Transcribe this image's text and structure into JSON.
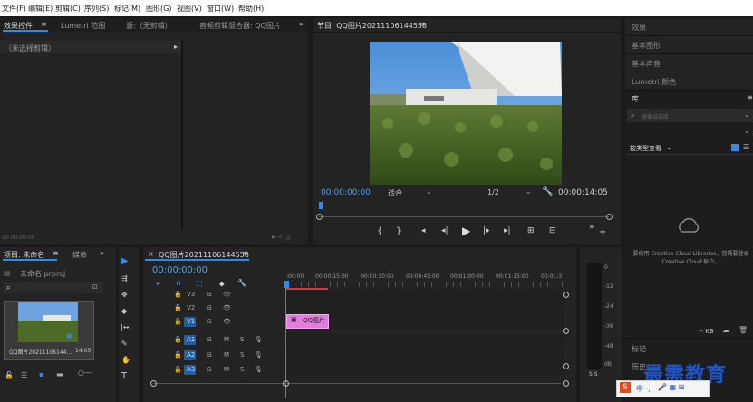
{
  "menu": [
    "文件(F)",
    "编辑(E)",
    "剪辑(C)",
    "序列(S)",
    "标记(M)",
    "图形(G)",
    "视图(V)",
    "窗口(W)",
    "帮助(H)"
  ],
  "source_panel": {
    "tabs": [
      "效果控件",
      "Lumetri 范围",
      "源:（无剪辑）",
      "音频剪辑混合器: QQ图片"
    ],
    "no_clip": "（未选择剪辑）",
    "timecode": "00:00:00:00"
  },
  "program": {
    "title": "节目: QQ图片20211106144558",
    "timecode": "00:00:00:00",
    "fit": "适合",
    "ratio": "1/2",
    "duration": "00:00:14:05"
  },
  "right_panel": {
    "items": [
      "效果",
      "基本图形",
      "基本声音",
      "Lumetri 颜色"
    ],
    "library_title": "库",
    "search_placeholder": "搜索当前库",
    "view_by": "按类型查看",
    "cc_message": "要使用 Creative Cloud Libraries，您需要登录 Creative Cloud 帐户。",
    "kb": "-- KB",
    "markers_title": "标记",
    "history_title": "历史"
  },
  "project": {
    "title": "项目: 未命名",
    "tab2": "媒体",
    "file": "未命名.prproj",
    "clip_name": "QQ图片20211106144...",
    "clip_duration": "14:05"
  },
  "timeline": {
    "title": "QQ图片20211106144558",
    "timecode": "00:00:00:00",
    "ruler": [
      ":00:00",
      "00:00:15:00",
      "00:00:30:00",
      "00:00:45:00",
      "00:01:00:00",
      "00:01:15:00",
      "00:01:3"
    ],
    "tracks": [
      {
        "name": "V3",
        "kind": "video",
        "on": false
      },
      {
        "name": "V2",
        "kind": "video",
        "on": false
      },
      {
        "name": "V1",
        "kind": "video",
        "on": true
      },
      {
        "name": "A1",
        "kind": "audio",
        "on": true
      },
      {
        "name": "A2",
        "kind": "audio",
        "on": true
      },
      {
        "name": "A3",
        "kind": "audio",
        "on": true
      }
    ],
    "clip_label": "QQ图片",
    "m": "M",
    "s": "S"
  },
  "meter": {
    "scale": [
      "0",
      "-12",
      "-24",
      "-36",
      "-48",
      "dB"
    ],
    "s_labels": "S  S"
  },
  "watermark": {
    "text": "最需教育",
    "ime": "中 ·,"
  },
  "colors": {
    "accent": "#2d8ceb",
    "clip": "#e57be0",
    "panel": "#232323"
  }
}
